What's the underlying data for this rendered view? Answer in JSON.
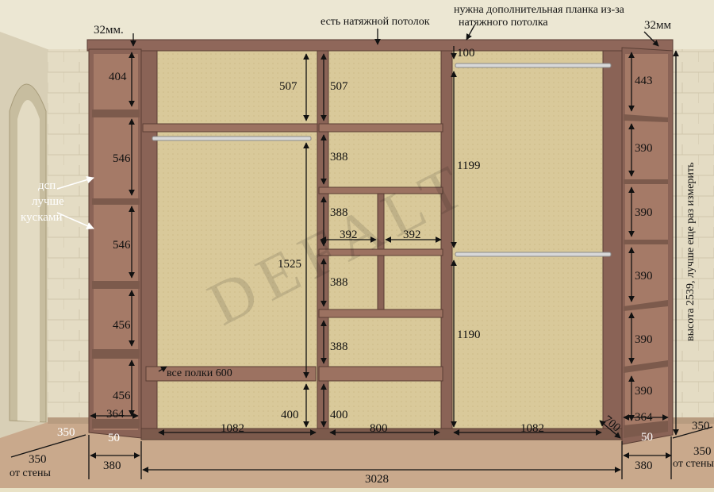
{
  "notes": {
    "ceiling": "есть натяжной потолок",
    "extra_plank": "нужна дополнительная планка из-за натяжного потолка",
    "left_side": "дсп лучше кусками",
    "height_check": "высота 2539, лучше еще раз измерить",
    "all_shelves": "все полки 600",
    "from_wall_left": "от стены",
    "from_wall_right": "от стены"
  },
  "watermark": "DEFALT",
  "dimensions": {
    "total_width": "3028",
    "left_depth": "380",
    "right_depth": "380",
    "left_wall_gap": "350",
    "right_wall_gap": "350",
    "left_wall_gap2": "350",
    "right_wall_gap2": "350",
    "thickness_left": "32мм.",
    "thickness_right": "32мм",
    "left_cab": [
      "404",
      "546",
      "546",
      "456",
      "456",
      "364",
      "50"
    ],
    "sec1_top": "507",
    "sec1_rod": "1525",
    "sec1_bottom": "400",
    "sec1_width": "1082",
    "sec2": [
      "507",
      "388",
      "388",
      "388",
      "388",
      "400"
    ],
    "sec2_half_left": "392",
    "sec2_half_right": "392",
    "sec2_width": "800",
    "sec3": [
      "100",
      "1199",
      "1190"
    ],
    "sec3_width": "1082",
    "sec3_depth": "700",
    "right_cab": [
      "443",
      "390",
      "390",
      "390",
      "390",
      "390",
      "364",
      "50"
    ]
  }
}
